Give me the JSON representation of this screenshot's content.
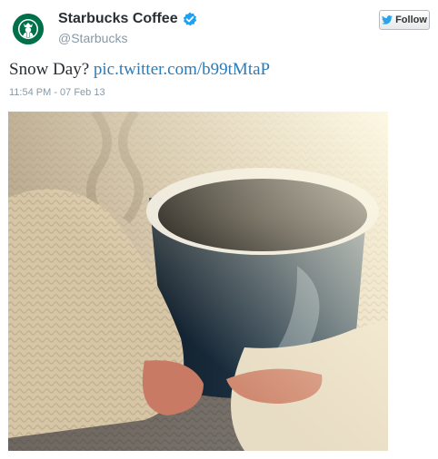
{
  "account": {
    "name": "Starbucks Coffee",
    "handle": "@Starbucks",
    "verified": true,
    "avatar_icon": "starbucks-siren-logo",
    "brand_color": "#00704a"
  },
  "follow_button": {
    "label": "Follow",
    "icon": "twitter-bird-icon"
  },
  "tweet": {
    "text": "Snow Day?",
    "link": "pic.twitter.com/b99tMtaP",
    "timestamp": "11:54 PM - 07 Feb 13",
    "link_color": "#2b7bb9"
  },
  "media": {
    "type": "photo"
  }
}
